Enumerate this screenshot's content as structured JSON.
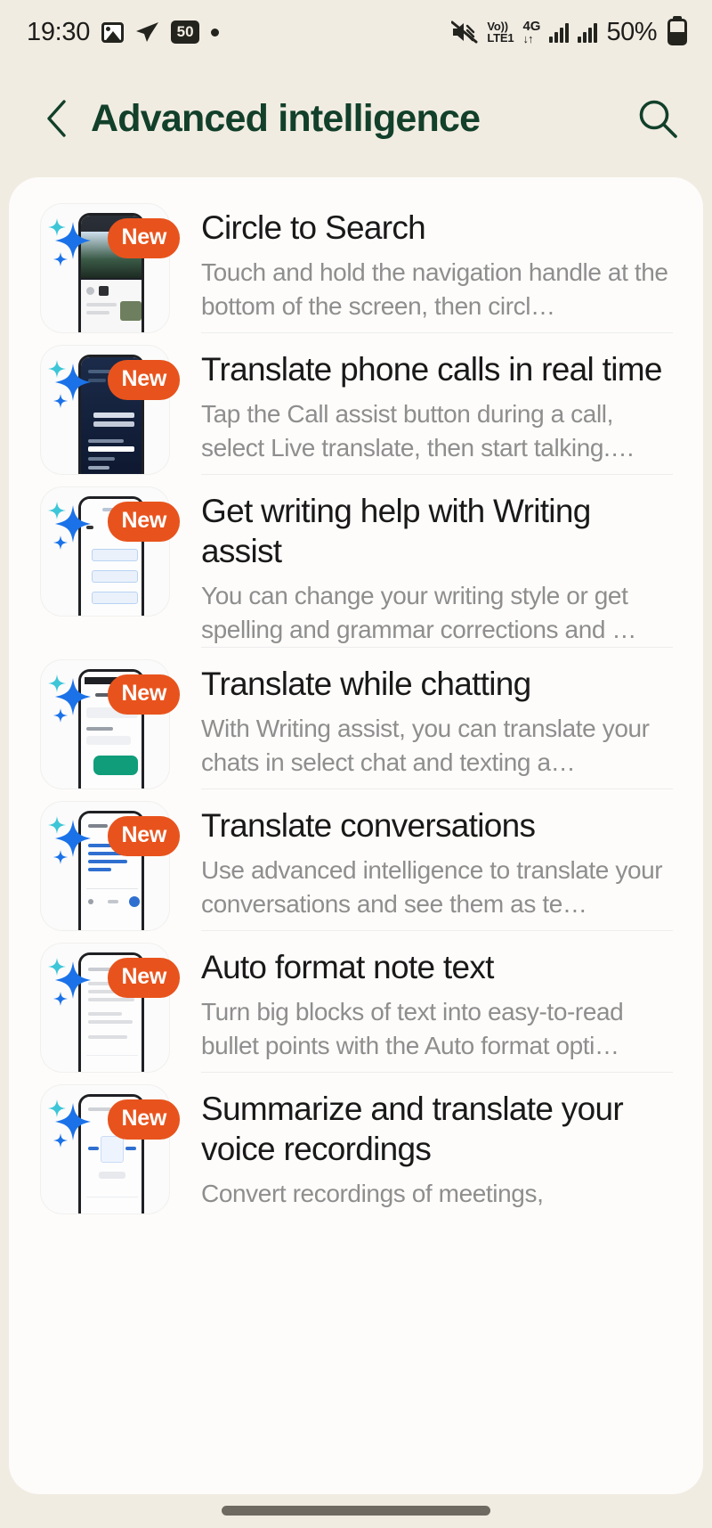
{
  "status_bar": {
    "time": "19:30",
    "icons_left": [
      "image-icon",
      "telegram-plane-icon",
      "notification-count-badge",
      "dot-icon"
    ],
    "notification_count": "50",
    "icons_right": [
      "mute-icon",
      "volte-icon",
      "network-4g-icon",
      "signal-icon",
      "signal-icon"
    ],
    "volte_top": "Vo))",
    "volte_bottom": "LTE1",
    "network": "4G",
    "network_arrows": "↓↑",
    "battery_percent": "50%"
  },
  "header": {
    "back_icon": "chevron-left-icon",
    "title": "Advanced intelligence",
    "search_icon": "search-icon",
    "title_color": "#12402a"
  },
  "colors": {
    "page_background": "#f1ece2",
    "card_background": "#fdfcfa",
    "badge_orange": "#e8531d",
    "title_text": "#191919",
    "desc_text": "#8e8e8e"
  },
  "badge_label": "New",
  "features": [
    {
      "title": "Circle to Search",
      "desc": "Touch and hold the navigation handle at the bottom of the screen, then circl…",
      "badge": "New",
      "thumb": "circle-to-search-thumbnail"
    },
    {
      "title": "Translate phone calls in real time",
      "desc": "Tap the Call assist button during a call, select Live translate, then start talking.…",
      "badge": "New",
      "thumb": "call-translate-thumbnail"
    },
    {
      "title": "Get writing help with Writing assist",
      "desc": "You can change your writing style or get spelling and grammar corrections and …",
      "badge": "New",
      "thumb": "writing-assist-thumbnail"
    },
    {
      "title": "Translate while chatting",
      "desc": "With Writing assist, you can translate your chats in select chat and texting a…",
      "badge": "New",
      "thumb": "chat-translate-thumbnail"
    },
    {
      "title": "Translate conversations",
      "desc": "Use advanced intelligence to translate your conversations and see them as te…",
      "badge": "New",
      "thumb": "conversation-translate-thumbnail"
    },
    {
      "title": "Auto format note text",
      "desc": "Turn big blocks of text into easy-to-read bullet points with the Auto format opti…",
      "badge": "New",
      "thumb": "auto-format-thumbnail"
    },
    {
      "title": "Summarize and translate your voice recordings",
      "desc": "Convert recordings of meetings,",
      "badge": "New",
      "thumb": "voice-recording-thumbnail"
    }
  ]
}
